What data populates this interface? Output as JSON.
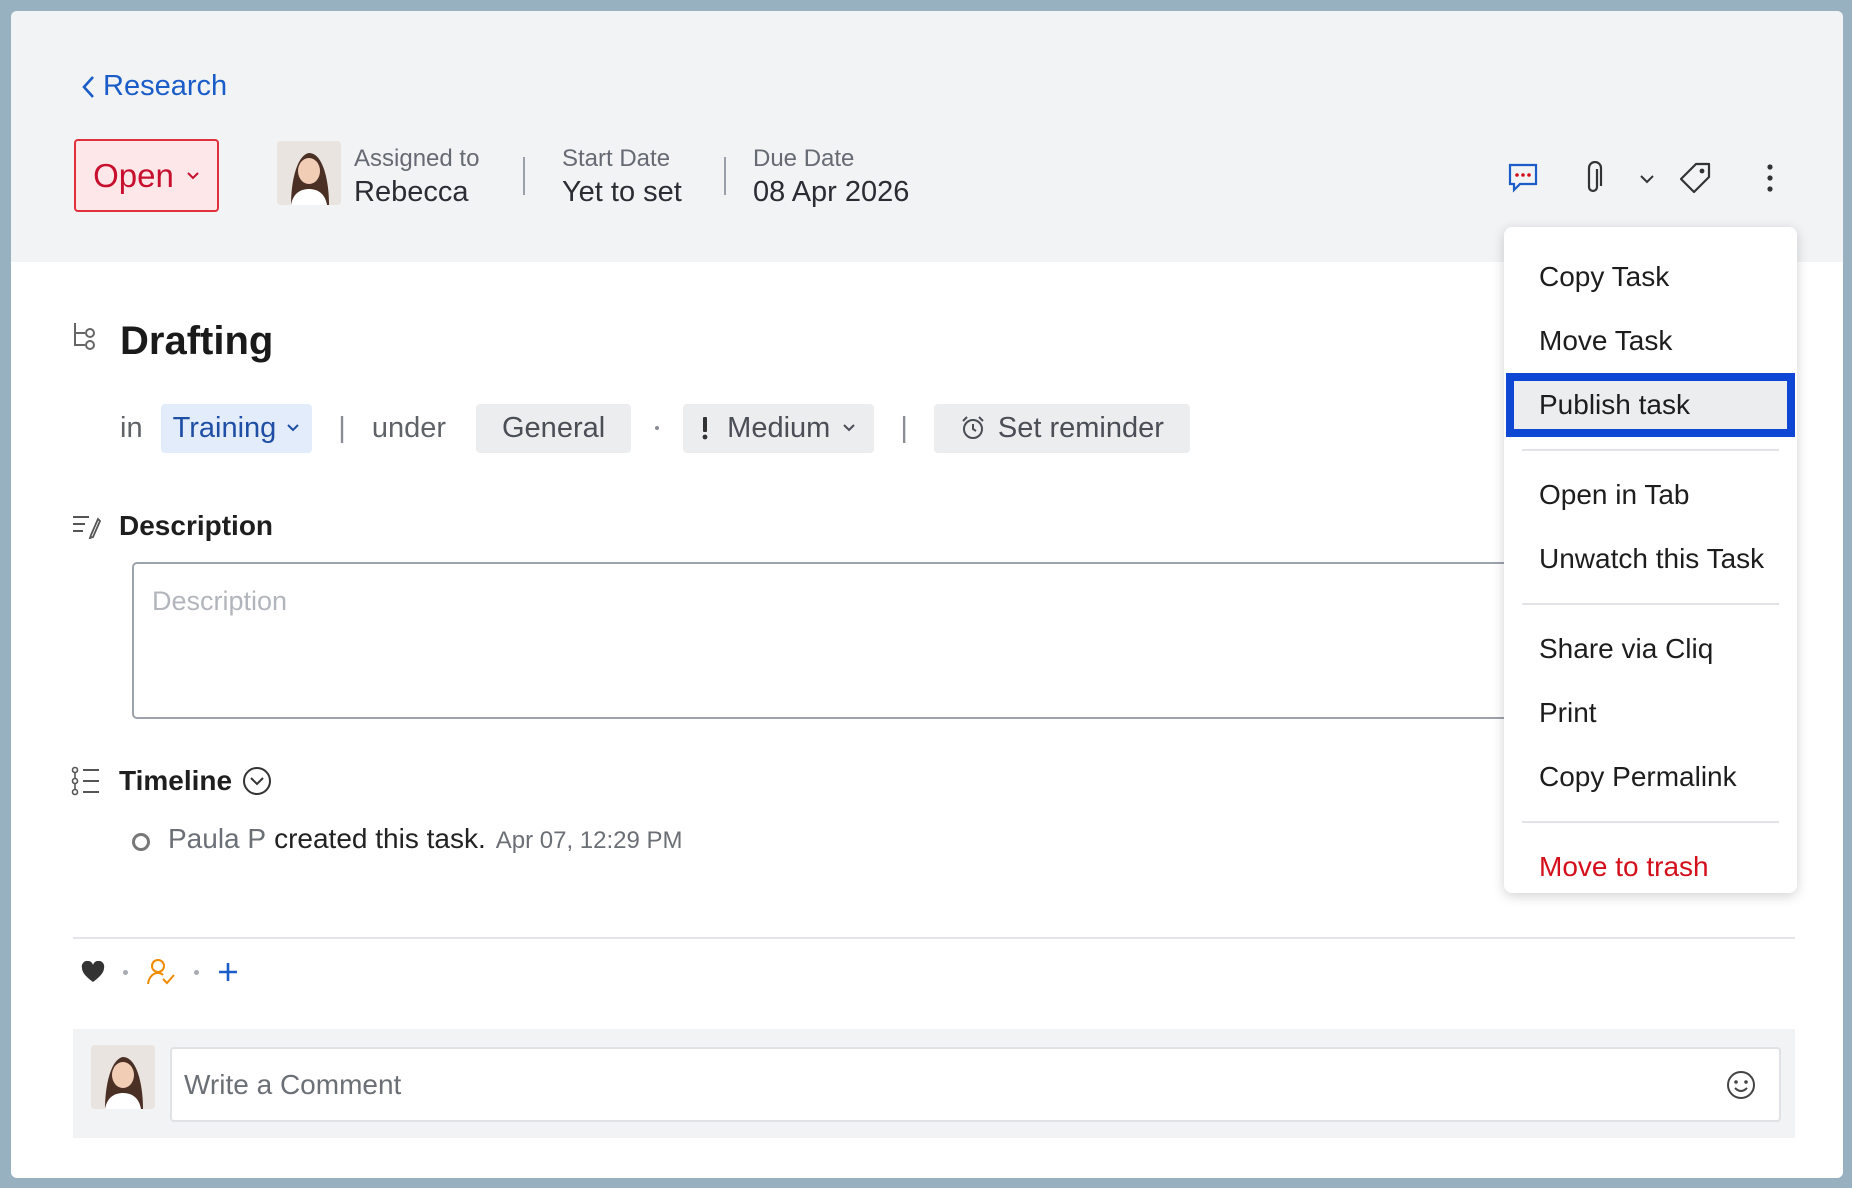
{
  "breadcrumb": {
    "label": "Research"
  },
  "status": {
    "label": "Open"
  },
  "assignee": {
    "label": "Assigned to",
    "name": "Rebecca"
  },
  "start_date": {
    "label": "Start Date",
    "value": "Yet to set"
  },
  "due_date": {
    "label": "Due Date",
    "value": "08 Apr 2026"
  },
  "task": {
    "title": "Drafting",
    "in_label": "in",
    "project": "Training",
    "under_label": "under",
    "group": "General",
    "priority": "Medium",
    "reminder": "Set reminder"
  },
  "description": {
    "title": "Description",
    "placeholder": "Description"
  },
  "timeline": {
    "title": "Timeline",
    "items": [
      {
        "user": "Paula P",
        "action": "created this task.",
        "time": "Apr 07, 12:29 PM"
      }
    ]
  },
  "comment": {
    "placeholder": "Write a Comment"
  },
  "menu": {
    "items": [
      {
        "label": "Copy Task"
      },
      {
        "label": "Move Task"
      },
      {
        "label": "Publish task",
        "active": true
      },
      {
        "label": "Open in Tab"
      },
      {
        "label": "Unwatch this Task"
      },
      {
        "label": "Share via Cliq"
      },
      {
        "label": "Print"
      },
      {
        "label": "Copy Permalink"
      },
      {
        "label": "Move to trash",
        "danger": true
      }
    ]
  },
  "colors": {
    "accent": "#1a5cc8",
    "status_red": "#c8102e",
    "focus_outline": "#0d47d4",
    "danger": "#d40f1b"
  }
}
